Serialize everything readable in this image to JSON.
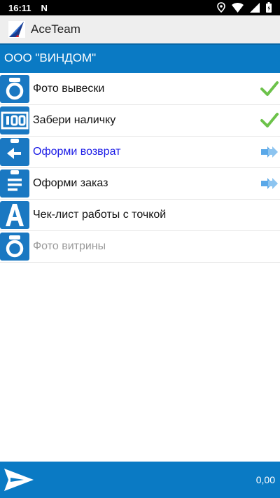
{
  "status_bar": {
    "time": "16:11",
    "notification": "N",
    "icons": [
      "location-icon",
      "wifi-icon",
      "signal-icon",
      "battery-icon"
    ]
  },
  "app": {
    "title": "AceTeam",
    "logo_icon": "aceteam-logo-icon"
  },
  "company": {
    "name": "ООО \"ВИНДОМ\""
  },
  "tasks": [
    {
      "label": "Фото вывески",
      "icon": "camera-icon",
      "status": "done",
      "state": "normal"
    },
    {
      "label": "Забери наличку",
      "icon": "cash-icon",
      "status": "done",
      "state": "normal"
    },
    {
      "label": "Оформи возврат",
      "icon": "return-clipboard-icon",
      "status": "next",
      "state": "active"
    },
    {
      "label": "Оформи заказ",
      "icon": "order-clipboard-icon",
      "status": "next",
      "state": "normal"
    },
    {
      "label": "Чек-лист работы с точкой",
      "icon": "letter-a-icon",
      "status": "none",
      "state": "normal"
    },
    {
      "label": "Фото витрины",
      "icon": "camera-icon",
      "status": "none",
      "state": "disabled"
    }
  ],
  "bottom_bar": {
    "total": "0,00",
    "send_icon": "send-icon"
  },
  "colors": {
    "accent": "#0a7ac4",
    "icon_blue": "#1a78c2",
    "active_text": "#1a1ae6",
    "disabled_text": "#9a9a9a",
    "check_green": "#6cc24a",
    "arrow_blue": "#5aa8e8"
  }
}
